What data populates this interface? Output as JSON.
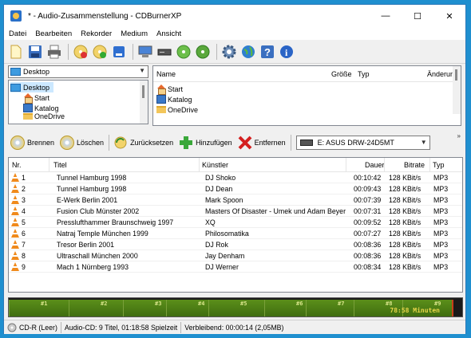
{
  "window": {
    "title": "* - Audio-Zusammenstellung - CDBurnerXP",
    "minimize": "—",
    "maximize": "☐",
    "close": "✕"
  },
  "menu": [
    "Datei",
    "Bearbeiten",
    "Rekorder",
    "Medium",
    "Ansicht"
  ],
  "toolbar_icons": [
    "new-icon",
    "save-icon",
    "print-icon",
    "disc-add-icon",
    "disc-burn-icon",
    "blue-square-icon",
    "computer-icon",
    "drive-icon",
    "disc-green-icon",
    "disc-green2-icon",
    "gear-icon",
    "globe-icon",
    "help-icon",
    "info-icon"
  ],
  "tree": {
    "combo_value": "Desktop",
    "items": [
      "Desktop",
      "Start",
      "Katalog",
      "OneDrive"
    ]
  },
  "files": {
    "columns": [
      "Name",
      "Größe",
      "Typ",
      "Änderun"
    ],
    "rows": [
      "Start",
      "Katalog",
      "OneDrive"
    ]
  },
  "actions": {
    "burn": "Brennen",
    "delete": "Löschen",
    "reset": "Zurücksetzen",
    "add": "Hinzufügen",
    "remove": "Entfernen",
    "drive": "E: ASUS DRW-24D5MT"
  },
  "tracks": {
    "columns": [
      "Nr.",
      "Titel",
      "Künstler",
      "Dauer",
      "Bitrate",
      "Typ"
    ],
    "rows": [
      {
        "nr": "1",
        "title": "Tunnel Hamburg 1998",
        "artist": "DJ Shoko",
        "duration": "00:10:42",
        "bitrate": "128 KBit/s",
        "type": "MP3"
      },
      {
        "nr": "2",
        "title": "Tunnel Hamburg 1998",
        "artist": "DJ Dean",
        "duration": "00:09:43",
        "bitrate": "128 KBit/s",
        "type": "MP3"
      },
      {
        "nr": "3",
        "title": "E-Werk Berlin 2001",
        "artist": "Mark Spoon",
        "duration": "00:07:39",
        "bitrate": "128 KBit/s",
        "type": "MP3"
      },
      {
        "nr": "4",
        "title": "Fusion Club Münster 2002",
        "artist": "Masters Of Disaster - Umek und Adam Beyer",
        "duration": "00:07:31",
        "bitrate": "128 KBit/s",
        "type": "MP3"
      },
      {
        "nr": "5",
        "title": "Presslufthammer Braunschweig 1997",
        "artist": "XQ",
        "duration": "00:09:52",
        "bitrate": "128 KBit/s",
        "type": "MP3"
      },
      {
        "nr": "6",
        "title": "Natraj Temple München 1999",
        "artist": "Philosomatika",
        "duration": "00:07:27",
        "bitrate": "128 KBit/s",
        "type": "MP3"
      },
      {
        "nr": "7",
        "title": "Tresor Berlin 2001",
        "artist": "DJ Rok",
        "duration": "00:08:36",
        "bitrate": "128 KBit/s",
        "type": "MP3"
      },
      {
        "nr": "8",
        "title": "Ultraschall München 2000",
        "artist": "Jay Denham",
        "duration": "00:08:36",
        "bitrate": "128 KBit/s",
        "type": "MP3"
      },
      {
        "nr": "9",
        "title": "Mach 1 Nürnberg 1993",
        "artist": "DJ Werner",
        "duration": "00:08:34",
        "bitrate": "128 KBit/s",
        "type": "MP3"
      }
    ]
  },
  "timeline": {
    "markers": [
      "#1",
      "#2",
      "#3",
      "#4",
      "#5",
      "#6",
      "#7",
      "#8",
      "#9"
    ],
    "total": "78:58 Minuten",
    "fill_fraction": 0.977
  },
  "status": {
    "media": "CD-R (Leer)",
    "info": "Audio-CD: 9 Titel, 01:18:58 Spielzeit",
    "remaining": "Verbleibend: 00:00:14 (2,05MB)"
  }
}
